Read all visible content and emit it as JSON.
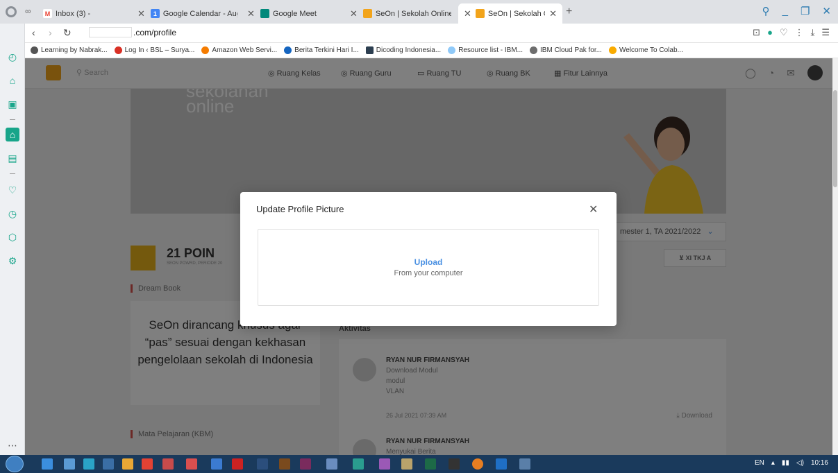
{
  "browser": {
    "tabs": [
      {
        "label": "Inbox (3) -",
        "icon": "gmail-icon",
        "color": "#ea4335",
        "active": false
      },
      {
        "label": "Google Calendar - August",
        "icon": "calendar-icon",
        "color": "#4285f4",
        "active": false
      },
      {
        "label": "Google Meet",
        "icon": "meet-icon",
        "color": "#00897b",
        "active": false
      },
      {
        "label": "SeOn | Sekolah Online",
        "icon": "seon-icon",
        "color": "#f2a41b",
        "active": false
      },
      {
        "label": "SeOn | Sekolah Online",
        "icon": "seon-icon",
        "color": "#f2a41b",
        "active": true
      }
    ],
    "url": ".com/profile",
    "bookmarks": [
      {
        "label": "Learning by Nabrak...",
        "color": "#555555"
      },
      {
        "label": "Log In ‹ BSL – Surya...",
        "color": "#d93025"
      },
      {
        "label": "Amazon Web Servi...",
        "color": "#f90000"
      },
      {
        "label": "Berita Terkini Hari I...",
        "color": "#1565c0"
      },
      {
        "label": "Dicoding Indonesia...",
        "color": "#2c3e50"
      },
      {
        "label": "Resource list - IBM...",
        "color": "#90caf9"
      },
      {
        "label": "IBM Cloud Pak for...",
        "color": "#6d6d6d"
      },
      {
        "label": "Welcome To Colab...",
        "color": "#f9ab00"
      }
    ]
  },
  "site": {
    "nav": {
      "search_placeholder": "Search",
      "links": [
        "Ruang Kelas",
        "Ruang Guru",
        "Ruang TU",
        "Ruang BK",
        "Fitur Lainnya"
      ]
    },
    "hero_text_line1": "sekolahan",
    "hero_text_line2": "online",
    "semester": "mester 1, TA 2021/2022",
    "class_chip": "XI TKJ A",
    "poin_title": "21 POIN",
    "poin_sub": "SEON POWRD, PERIODE 20",
    "dream_label": "Dream Book",
    "dream_text": "SeOn dirancang khusus agar “pas” sesuai dengan kekhasan pengelolaan sekolah di Indonesia",
    "aktivitas_title": "Aktivitas",
    "mapel_label": "Mata Pelajaran (KBM)",
    "activities": [
      {
        "name": "RYAN NUR FIRMANSYAH",
        "line1": "Download Modul",
        "line2": "modul",
        "line3": "VLAN",
        "time": "26 Jul 2021 07:39 AM",
        "action": "Download"
      },
      {
        "name": "RYAN NUR FIRMANSYAH",
        "line1": "Menyukai Berita",
        "line2": "",
        "line3": "",
        "time": "",
        "action": ""
      }
    ]
  },
  "modal": {
    "title": "Update Profile Picture",
    "upload_label": "Upload",
    "upload_sub": "From your computer"
  },
  "taskbar": {
    "lang": "EN",
    "time": "10:16"
  }
}
